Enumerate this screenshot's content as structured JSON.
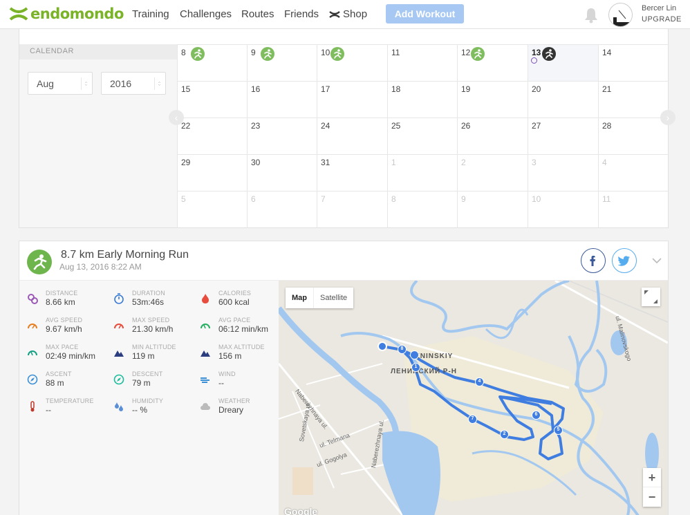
{
  "nav": {
    "brand": "endomondo",
    "items": [
      "Training",
      "Challenges",
      "Routes",
      "Friends"
    ],
    "shop": "Shop",
    "add_workout": "Add Workout",
    "user_name": "Bercer Lin",
    "upgrade": "UPGRADE"
  },
  "calendar": {
    "label": "CALENDAR",
    "month": "Aug",
    "year": "2016",
    "rows": [
      [
        {
          "d": "8",
          "act": "run"
        },
        {
          "d": "9",
          "act": "run"
        },
        {
          "d": "10",
          "act": "run"
        },
        {
          "d": "11"
        },
        {
          "d": "12",
          "act": "run"
        },
        {
          "d": "13",
          "act": "run-dark",
          "bold": true,
          "today": true
        },
        {
          "d": "14"
        }
      ],
      [
        {
          "d": "15"
        },
        {
          "d": "16"
        },
        {
          "d": "17"
        },
        {
          "d": "18"
        },
        {
          "d": "19"
        },
        {
          "d": "20"
        },
        {
          "d": "21"
        }
      ],
      [
        {
          "d": "22"
        },
        {
          "d": "23"
        },
        {
          "d": "24"
        },
        {
          "d": "25"
        },
        {
          "d": "26"
        },
        {
          "d": "27"
        },
        {
          "d": "28"
        }
      ],
      [
        {
          "d": "29"
        },
        {
          "d": "30"
        },
        {
          "d": "31"
        },
        {
          "d": "1",
          "muted": true
        },
        {
          "d": "2",
          "muted": true
        },
        {
          "d": "3",
          "muted": true
        },
        {
          "d": "4",
          "muted": true
        }
      ],
      [
        {
          "d": "5",
          "muted": true
        },
        {
          "d": "6",
          "muted": true
        },
        {
          "d": "7",
          "muted": true
        },
        {
          "d": "8",
          "muted": true
        },
        {
          "d": "9",
          "muted": true
        },
        {
          "d": "10",
          "muted": true
        },
        {
          "d": "11",
          "muted": true
        }
      ]
    ]
  },
  "workout": {
    "title": "8.7 km Early Morning Run",
    "date": "Aug 13, 2016 8:22 AM",
    "stats": [
      {
        "label": "DISTANCE",
        "value": "8.66 km",
        "icon": "distance-icon",
        "color": "#9b59b6"
      },
      {
        "label": "DURATION",
        "value": "53m:46s",
        "icon": "stopwatch-icon",
        "color": "#3a7bd5"
      },
      {
        "label": "CALORIES",
        "value": "600 kcal",
        "icon": "flame-icon",
        "color": "#e74c3c"
      },
      {
        "label": "AVG SPEED",
        "value": "9.67 km/h",
        "icon": "speedometer-icon",
        "color": "#e67e22"
      },
      {
        "label": "MAX SPEED",
        "value": "21.30 km/h",
        "icon": "speedometer-icon",
        "color": "#e74c3c"
      },
      {
        "label": "AVG PACE",
        "value": "06:12 min/km",
        "icon": "pace-icon",
        "color": "#27ae60"
      },
      {
        "label": "MAX PACE",
        "value": "02:49 min/km",
        "icon": "pace-icon",
        "color": "#16a085"
      },
      {
        "label": "MIN ALTITUDE",
        "value": "119 m",
        "icon": "mountain-icon",
        "color": "#2c3e80"
      },
      {
        "label": "MAX ALTITUDE",
        "value": "156 m",
        "icon": "mountain-icon",
        "color": "#2c3e80"
      },
      {
        "label": "ASCENT",
        "value": "88 m",
        "icon": "compass-icon",
        "color": "#3a8fd5"
      },
      {
        "label": "DESCENT",
        "value": "79 m",
        "icon": "compass-icon",
        "color": "#1abc9c"
      },
      {
        "label": "WIND",
        "value": "--",
        "icon": "wind-icon",
        "color": "#3a8fd5"
      },
      {
        "label": "TEMPERATURE",
        "value": "--",
        "icon": "thermometer-icon",
        "color": "#c0392b"
      },
      {
        "label": "HUMIDITY",
        "value": "-- %",
        "icon": "humidity-icon",
        "color": "#5b8fd5"
      },
      {
        "label": "WEATHER",
        "value": "Dreary",
        "icon": "cloud-icon",
        "color": "#bbbbbb"
      }
    ]
  },
  "map": {
    "map_label": "Map",
    "satellite_label": "Satellite",
    "zoom_in": "+",
    "zoom_out": "−",
    "attribution": "Google",
    "street_labels": [
      "LENINSKIY",
      "ЛЕНИНСКИЙ Р-Н",
      "Naberezhnaya ul.",
      "ul. Telmana",
      "ul. Gogolya",
      "Sovetskaya ul.",
      "ul. Malinovskogo",
      "Naberezhnaya ul."
    ],
    "markers": [
      "1",
      "2",
      "4",
      "5",
      "6",
      "7",
      "8"
    ],
    "route_color": "#3f7de0",
    "water_color": "#a3c8f0"
  }
}
